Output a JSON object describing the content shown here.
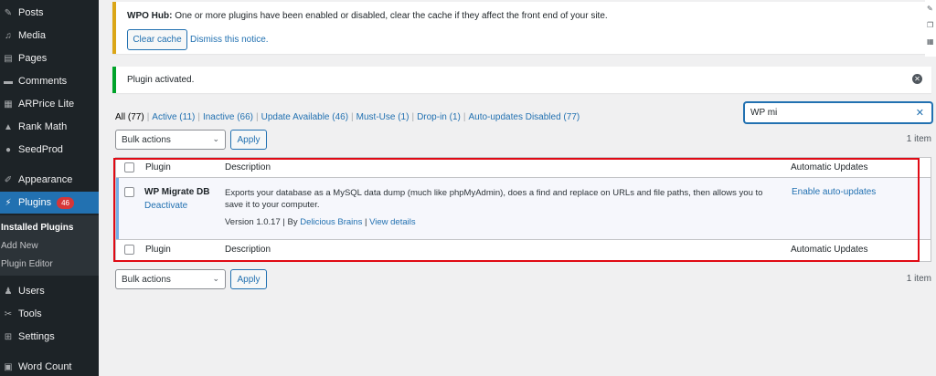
{
  "sidebar": {
    "items": [
      {
        "label": "Posts",
        "icon": "pushpin-icon"
      },
      {
        "label": "Media",
        "icon": "media-icon"
      },
      {
        "label": "Pages",
        "icon": "page-icon"
      },
      {
        "label": "Comments",
        "icon": "comment-icon"
      },
      {
        "label": "ARPrice Lite",
        "icon": "arprice-icon"
      },
      {
        "label": "Rank Math",
        "icon": "chart-icon"
      },
      {
        "label": "SeedProd",
        "icon": "seedprod-icon"
      },
      {
        "label": "Appearance",
        "icon": "paintbrush-icon"
      },
      {
        "label": "Plugins",
        "icon": "plug-icon",
        "badge": "46"
      },
      {
        "label": "Users",
        "icon": "users-icon"
      },
      {
        "label": "Tools",
        "icon": "wrench-icon"
      },
      {
        "label": "Settings",
        "icon": "settings-icon"
      },
      {
        "label": "Word Count",
        "icon": "wordcount-icon"
      }
    ],
    "submenu": [
      "Installed Plugins",
      "Add New",
      "Plugin Editor"
    ]
  },
  "notices": {
    "wpo_title": "WPO Hub:",
    "wpo_text": " One or more plugins have been enabled or disabled, clear the cache if they affect the front end of your site.",
    "clear_cache": "Clear cache",
    "dismiss": "Dismiss this notice.",
    "activated": "Plugin activated."
  },
  "filters": [
    "All (77)",
    "Active (11)",
    "Inactive (66)",
    "Update Available (46)",
    "Must-Use (1)",
    "Drop-in (1)",
    "Auto-updates Disabled (77)"
  ],
  "search": {
    "value": "WP mi"
  },
  "bulk": {
    "label": "Bulk actions",
    "apply": "Apply",
    "count": "1 item"
  },
  "table": {
    "headers": {
      "plugin": "Plugin",
      "description": "Description",
      "auto": "Automatic Updates"
    },
    "row": {
      "name": "WP Migrate DB",
      "deactivate": "Deactivate",
      "description": "Exports your database as a MySQL data dump (much like phpMyAdmin), does a find and replace on URLs and file paths, then allows you to save it to your computer.",
      "version": "Version 1.0.17 | By ",
      "author": "Delicious Brains",
      "sep": " | ",
      "details": "View details",
      "auto": "Enable auto-updates"
    }
  },
  "colors": {
    "accent": "#2271b1",
    "sidebar": "#1d2327",
    "highlight": "#e00a14",
    "badge": "#d63638"
  }
}
